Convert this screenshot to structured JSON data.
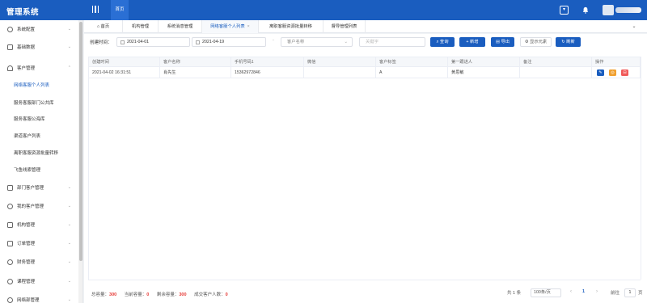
{
  "app": {
    "title": "管理系统",
    "top_tab": "首页"
  },
  "tabs": [
    {
      "label": "首页"
    },
    {
      "label": "机构管理"
    },
    {
      "label": "系统消息管理"
    },
    {
      "label": "网络客服个人列表"
    },
    {
      "label": "离职客服资源批量转移"
    },
    {
      "label": "督导管理列表"
    }
  ],
  "sidebar": {
    "items": [
      {
        "label": "系统配置"
      },
      {
        "label": "基础数据"
      },
      {
        "label": "客户管理"
      },
      {
        "label": "部门客户管理"
      },
      {
        "label": "我的客户管理"
      },
      {
        "label": "机构管理"
      },
      {
        "label": "订单管理"
      },
      {
        "label": "财务管理"
      },
      {
        "label": "课程管理"
      },
      {
        "label": "网络部管理"
      }
    ],
    "subitems": [
      {
        "label": "网络客服个人列表"
      },
      {
        "label": "服务客服部门公共库"
      },
      {
        "label": "服务客服公海库"
      },
      {
        "label": "渠道客户列表"
      },
      {
        "label": "离职客服资源批量转移"
      },
      {
        "label": "飞鱼线索管理"
      }
    ]
  },
  "filters": {
    "created_label": "创建时间：",
    "date_start": "2021-04-01",
    "date_end": "2021-04-19",
    "date_sep": "-",
    "select_placeholder": "客户名称",
    "keyword_placeholder": "关键字",
    "buttons": {
      "search": "查询",
      "add": "新增",
      "export": "导出",
      "show_elements": "显示元素",
      "refresh": "刷新"
    }
  },
  "table": {
    "columns": [
      "创建时间",
      "客户名称",
      "手机号码1",
      "微信",
      "客户标签",
      "第一跟进人",
      "备注",
      "操作"
    ],
    "rows": [
      [
        "2021-04-02 16:31:51",
        "肖先生",
        "15362972846",
        "",
        "A",
        "黄思敏",
        ""
      ]
    ]
  },
  "footer": {
    "total_capacity_label": "总容量：",
    "total_capacity": "300",
    "current_capacity_label": "当前容量：",
    "current_capacity": "0",
    "remaining_label": "剩余容量：",
    "remaining": "300",
    "deal_label": "成交客户人数：",
    "deal": "0",
    "total_count": "共 1 条",
    "page_size": "100条/页",
    "current_page": "1",
    "goto_label": "前往",
    "goto_page": "1",
    "page_unit": "页"
  },
  "colors": {
    "primary": "#1a5dbf",
    "edit": "#1a5dbf",
    "view": "#f0a030",
    "delete": "#f05a5a"
  }
}
